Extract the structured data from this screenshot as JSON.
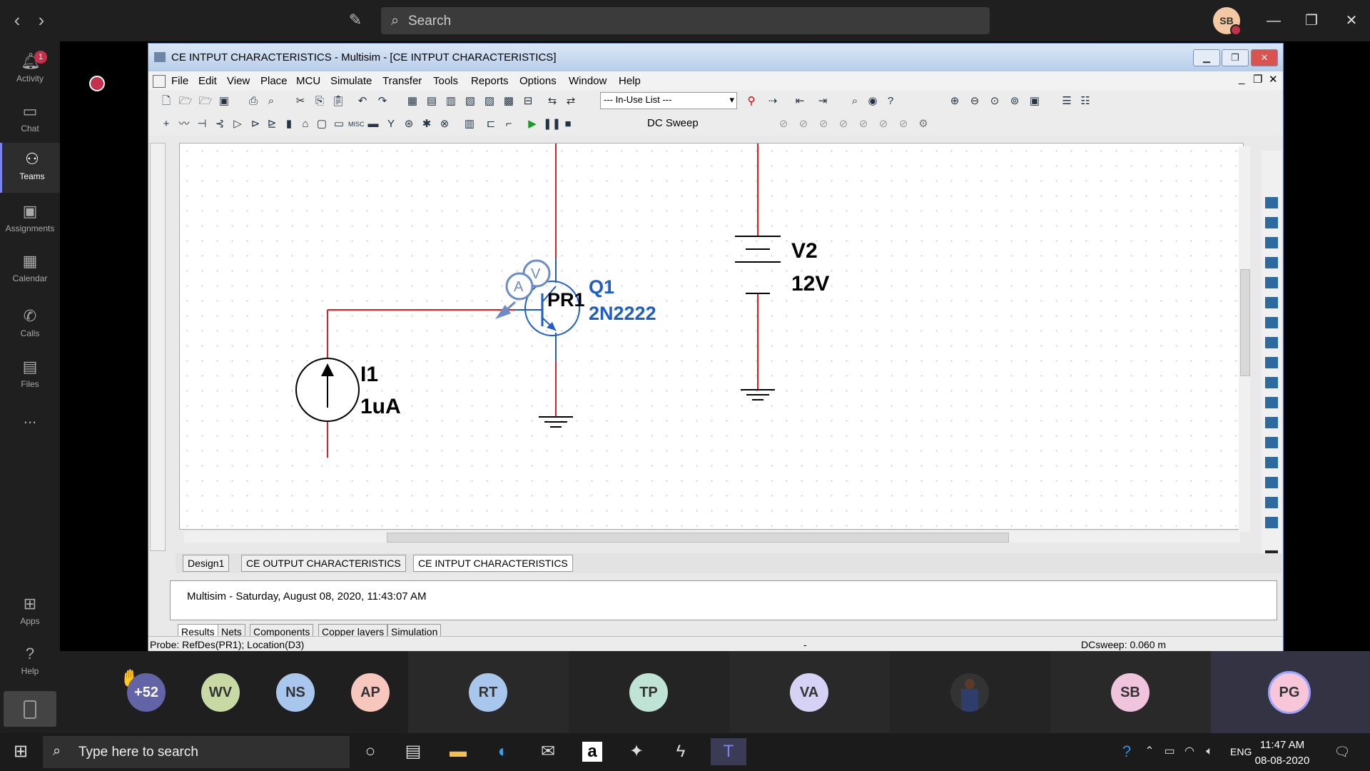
{
  "teams": {
    "search_placeholder": "Search",
    "user_initials": "SB",
    "rail": [
      {
        "label": "Activity",
        "icon": "bell-icon",
        "badge": "1"
      },
      {
        "label": "Chat",
        "icon": "chat-icon"
      },
      {
        "label": "Teams",
        "icon": "teams-icon"
      },
      {
        "label": "Assignments",
        "icon": "assignments-icon"
      },
      {
        "label": "Calendar",
        "icon": "calendar-icon"
      },
      {
        "label": "Calls",
        "icon": "phone-icon"
      },
      {
        "label": "Files",
        "icon": "files-icon"
      },
      {
        "label": "...",
        "icon": "more-icon"
      },
      {
        "label": "Apps",
        "icon": "apps-icon"
      },
      {
        "label": "Help",
        "icon": "help-icon"
      }
    ],
    "participants": [
      {
        "initials": "+52",
        "color": "#6264a7"
      },
      {
        "initials": "WV",
        "color": "#c9d9a3"
      },
      {
        "initials": "NS",
        "color": "#a9c7ec"
      },
      {
        "initials": "AP",
        "color": "#f7c6bd"
      },
      {
        "initials": "RT",
        "color": "#a9c7ec"
      },
      {
        "initials": "TP",
        "color": "#bfe3d4"
      },
      {
        "initials": "VA",
        "color": "#d6d2f5"
      },
      {
        "initials": "SB",
        "color": "#f0c4dd"
      },
      {
        "initials": "PG",
        "color": "#f7c6d9"
      }
    ]
  },
  "multisim": {
    "title": "CE INTPUT CHARACTERISTICS - Multisim - [CE INTPUT CHARACTERISTICS]",
    "menu": [
      "File",
      "Edit",
      "View",
      "Place",
      "MCU",
      "Simulate",
      "Transfer",
      "Tools",
      "Reports",
      "Options",
      "Window",
      "Help"
    ],
    "in_use_list": "--- In-Use List ---",
    "dc_sweep_label": "DC Sweep",
    "schematic": {
      "v2_name": "V2",
      "v2_value": "12V",
      "q1_name": "Q1",
      "q1_model": "2N2222",
      "probe_label": "PR1",
      "probe_v": "V",
      "probe_a": "A",
      "i1_name": "I1",
      "i1_value": "1uA"
    },
    "doc_tabs": [
      "Design1",
      "CE OUTPUT CHARACTERISTICS",
      "CE INTPUT CHARACTERISTICS"
    ],
    "output_line": "Multisim  -  Saturday, August 08, 2020, 11:43:07 AM",
    "result_tabs": [
      "Results",
      "Nets",
      "Components",
      "Copper layers",
      "Simulation"
    ],
    "status_left": "Probe: RefDes(PR1); Location(D3)",
    "status_mid": "-",
    "status_right": "DCsweep: 0.060 m"
  },
  "taskbar": {
    "search_placeholder": "Type here to search",
    "language": "ENG",
    "time": "11:47 AM",
    "date": "08-08-2020"
  }
}
